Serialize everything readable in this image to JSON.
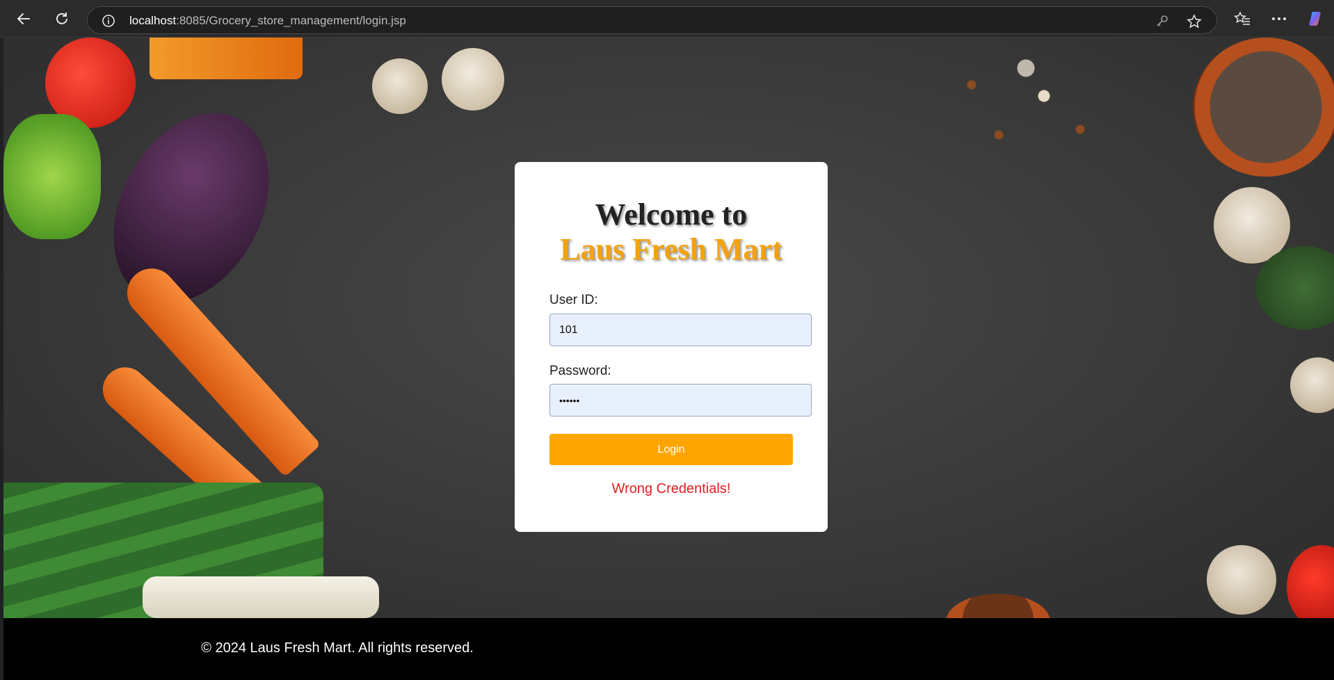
{
  "browser": {
    "url_host": "localhost",
    "url_rest": ":8085/Grocery_store_management/login.jsp"
  },
  "login": {
    "title_line1": "Welcome to",
    "title_line2": "Laus Fresh Mart",
    "userid_label": "User ID:",
    "userid_value": "101",
    "password_label": "Password:",
    "password_value": "••••••",
    "login_button": "Login",
    "error_message": "Wrong Credentials!"
  },
  "footer": {
    "text": "© 2024 Laus Fresh Mart. All rights reserved."
  },
  "colors": {
    "accent": "#ffa500",
    "title_gold": "#f3a20e",
    "error": "#e02020",
    "input_bg": "#e8f0fe"
  },
  "icons": [
    "back-icon",
    "refresh-icon",
    "info-icon",
    "key-icon",
    "star-icon",
    "favorites-icon",
    "more-icon",
    "copilot-icon"
  ]
}
